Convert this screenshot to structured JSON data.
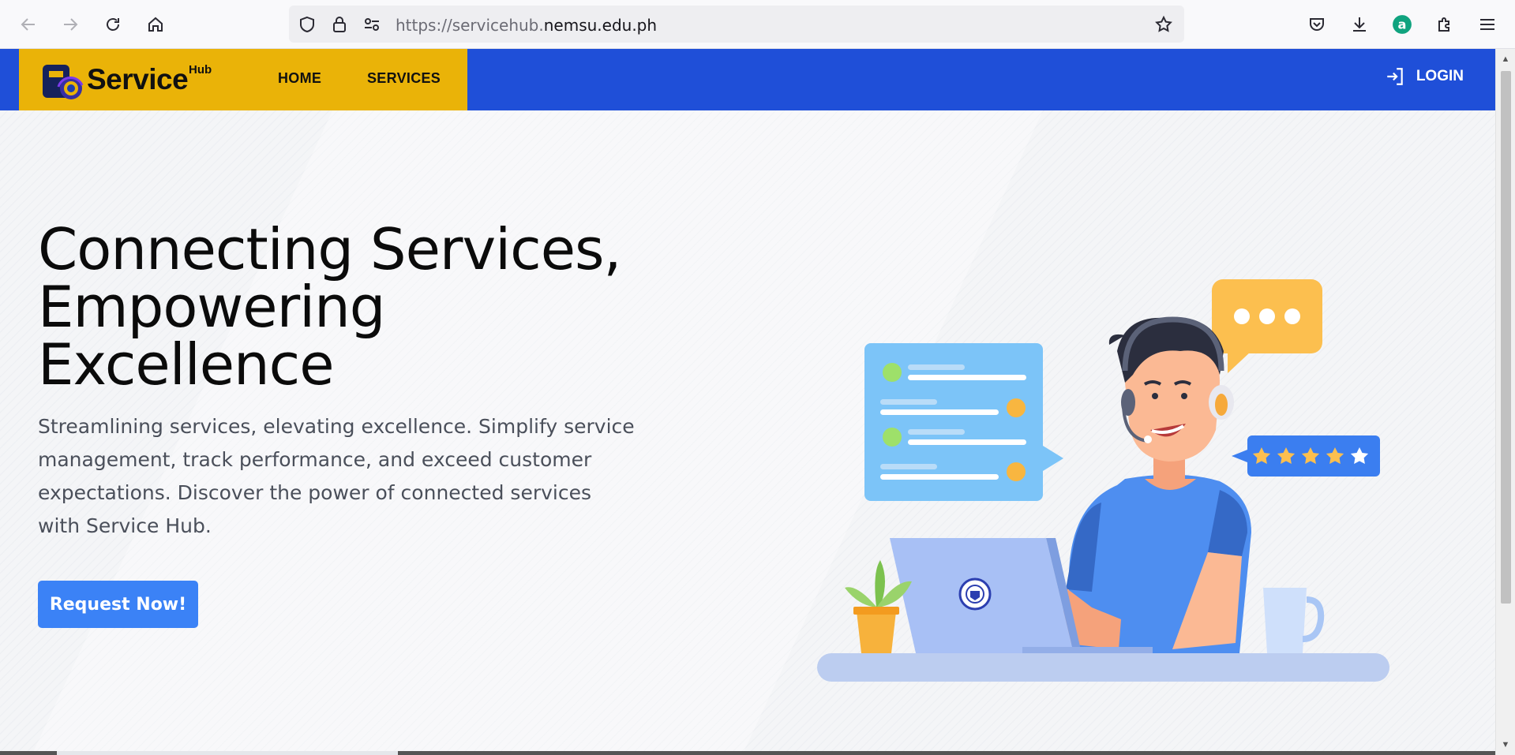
{
  "browser": {
    "url_prefix": "https://servicehub.",
    "url_domain": "nemsu.edu.ph"
  },
  "header": {
    "logo_text": "Service",
    "logo_sup": "Hub",
    "nav": [
      "HOME",
      "SERVICES"
    ],
    "login_label": "LOGIN"
  },
  "hero": {
    "title_lines": [
      "Connecting Services,",
      "Empowering",
      "Excellence"
    ],
    "description": "Streamlining services, elevating excellence. Simplify service management, track performance, and exceed customer expectations. Discover the power of connected services with Service Hub.",
    "cta_label": "Request Now!"
  },
  "colors": {
    "brand_blue": "#1f4fd8",
    "brand_yellow": "#eab308",
    "cta_blue": "#3b82f6"
  },
  "illustration": {
    "rating_stars": 5
  }
}
